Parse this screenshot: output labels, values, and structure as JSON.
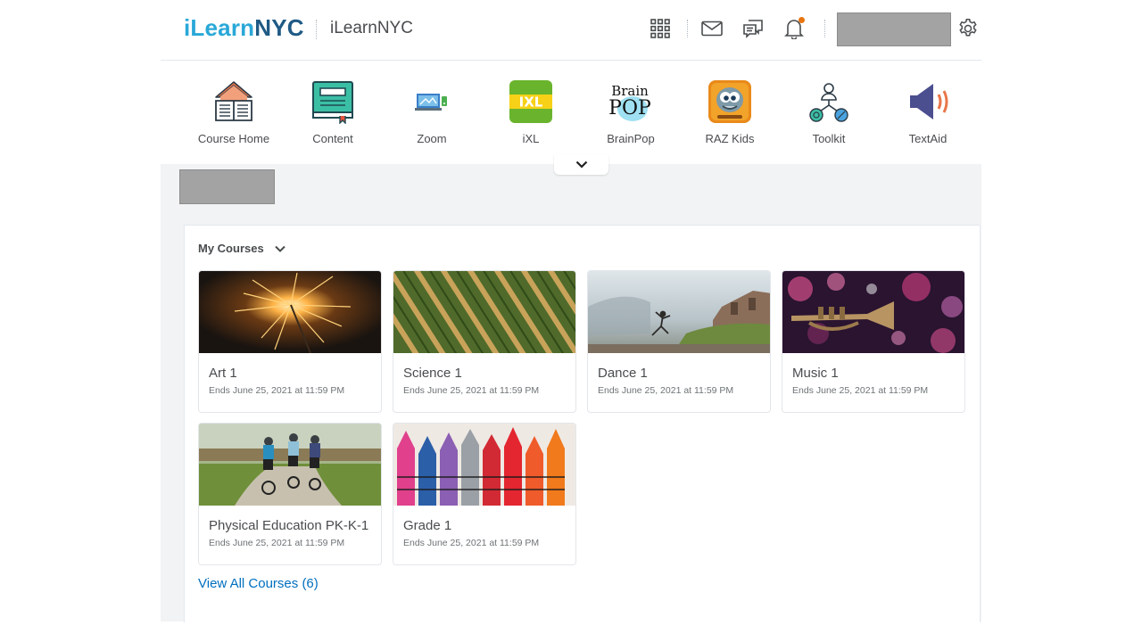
{
  "header": {
    "logo_prefix": "iLearn",
    "logo_suffix": "NYC",
    "org_name": "iLearnNYC",
    "icons": [
      "apps-grid-icon",
      "mail-icon",
      "chat-icon",
      "bell-icon",
      "gear-icon"
    ],
    "notification_dot_color": "#e87511"
  },
  "navbar": {
    "items": [
      {
        "label": "Course Home",
        "icon": "course-home-icon"
      },
      {
        "label": "Content",
        "icon": "content-book-icon"
      },
      {
        "label": "Zoom",
        "icon": "zoom-icon"
      },
      {
        "label": "iXL",
        "icon": "ixl-icon"
      },
      {
        "label": "BrainPop",
        "icon": "brainpop-icon"
      },
      {
        "label": "RAZ Kids",
        "icon": "raz-kids-icon"
      },
      {
        "label": "Toolkit",
        "icon": "toolkit-icon"
      },
      {
        "label": "TextAid",
        "icon": "textaid-icon"
      }
    ]
  },
  "widget": {
    "title": "My Courses",
    "courses": [
      {
        "name": "Art 1",
        "ends": "Ends June 25, 2021 at 11:59 PM",
        "image": "sparkler"
      },
      {
        "name": "Science 1",
        "ends": "Ends June 25, 2021 at 11:59 PM",
        "image": "crop-rows"
      },
      {
        "name": "Dance 1",
        "ends": "Ends June 25, 2021 at 11:59 PM",
        "image": "dancer"
      },
      {
        "name": "Music 1",
        "ends": "Ends June 25, 2021 at 11:59 PM",
        "image": "trumpet"
      },
      {
        "name": "Physical Education PK-K-1",
        "ends": "Ends June 25, 2021 at 11:59 PM",
        "image": "cyclists"
      },
      {
        "name": "Grade 1",
        "ends": "Ends June 25, 2021 at 11:59 PM",
        "image": "crayons"
      }
    ],
    "view_all": "View All Courses (6)"
  },
  "colors": {
    "link": "#006fbf",
    "logo_light": "#29a8d8",
    "logo_dark": "#1f5a85",
    "page_bg": "#f1f3f5"
  }
}
